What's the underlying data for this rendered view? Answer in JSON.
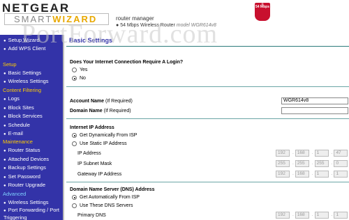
{
  "header": {
    "brand": "NETGEAR",
    "smart": "SMART",
    "wizard": "WIZARD",
    "title": "router manager",
    "subtitle": "54 Mbps Wireless Router",
    "model": "model WGR614v8",
    "badge": "G",
    "badge_small": "54 Mbps"
  },
  "watermark": "PortForward.com",
  "sidebar": {
    "items": [
      {
        "type": "item",
        "label": "Setup Wizard"
      },
      {
        "type": "item",
        "label": "Add WPS Client"
      },
      {
        "type": "section",
        "label": "Setup"
      },
      {
        "type": "item",
        "label": "Basic Settings"
      },
      {
        "type": "item",
        "label": "Wireless Settings"
      },
      {
        "type": "section",
        "label": "Content Filtering"
      },
      {
        "type": "item",
        "label": "Logs"
      },
      {
        "type": "item",
        "label": "Block Sites"
      },
      {
        "type": "item",
        "label": "Block Services"
      },
      {
        "type": "item",
        "label": "Schedule"
      },
      {
        "type": "item",
        "label": "E-mail"
      },
      {
        "type": "section",
        "label": "Maintenance"
      },
      {
        "type": "item",
        "label": "Router Status"
      },
      {
        "type": "item",
        "label": "Attached Devices"
      },
      {
        "type": "item",
        "label": "Backup Settings"
      },
      {
        "type": "item",
        "label": "Set Password"
      },
      {
        "type": "item",
        "label": "Router Upgrade"
      },
      {
        "type": "section",
        "label": "Advanced"
      },
      {
        "type": "item",
        "label": "Wireless Settings"
      },
      {
        "type": "item",
        "label": "Port Forwarding / Port Triggering"
      }
    ]
  },
  "main": {
    "title": "Basic Settings",
    "login_question": "Does Your Internet Connection Require A Login?",
    "login_yes": "Yes",
    "login_no": "No",
    "account_label": "Account Name",
    "account_req": "(If Required)",
    "account_value": "WGR614v8",
    "domain_label": "Domain Name",
    "domain_req": "(If Required)",
    "domain_value": "",
    "ip_heading": "Internet IP Address",
    "ip_dynamic": "Get Dynamically From ISP",
    "ip_static": "Use Static IP Address",
    "ip_address_label": "IP Address",
    "ip_address": [
      "192",
      "168",
      "1",
      "47"
    ],
    "subnet_label": "IP Subnet Mask",
    "subnet": [
      "255",
      "255",
      "255",
      "0"
    ],
    "gateway_label": "Gateway IP Address",
    "gateway": [
      "192",
      "168",
      "1",
      "1"
    ],
    "dns_heading": "Domain Name Server (DNS) Address",
    "dns_auto": "Get Automatically From ISP",
    "dns_manual": "Use These DNS Servers",
    "primary_dns_label": "Primary DNS",
    "primary_dns": [
      "192",
      "168",
      "1",
      "1"
    ]
  }
}
